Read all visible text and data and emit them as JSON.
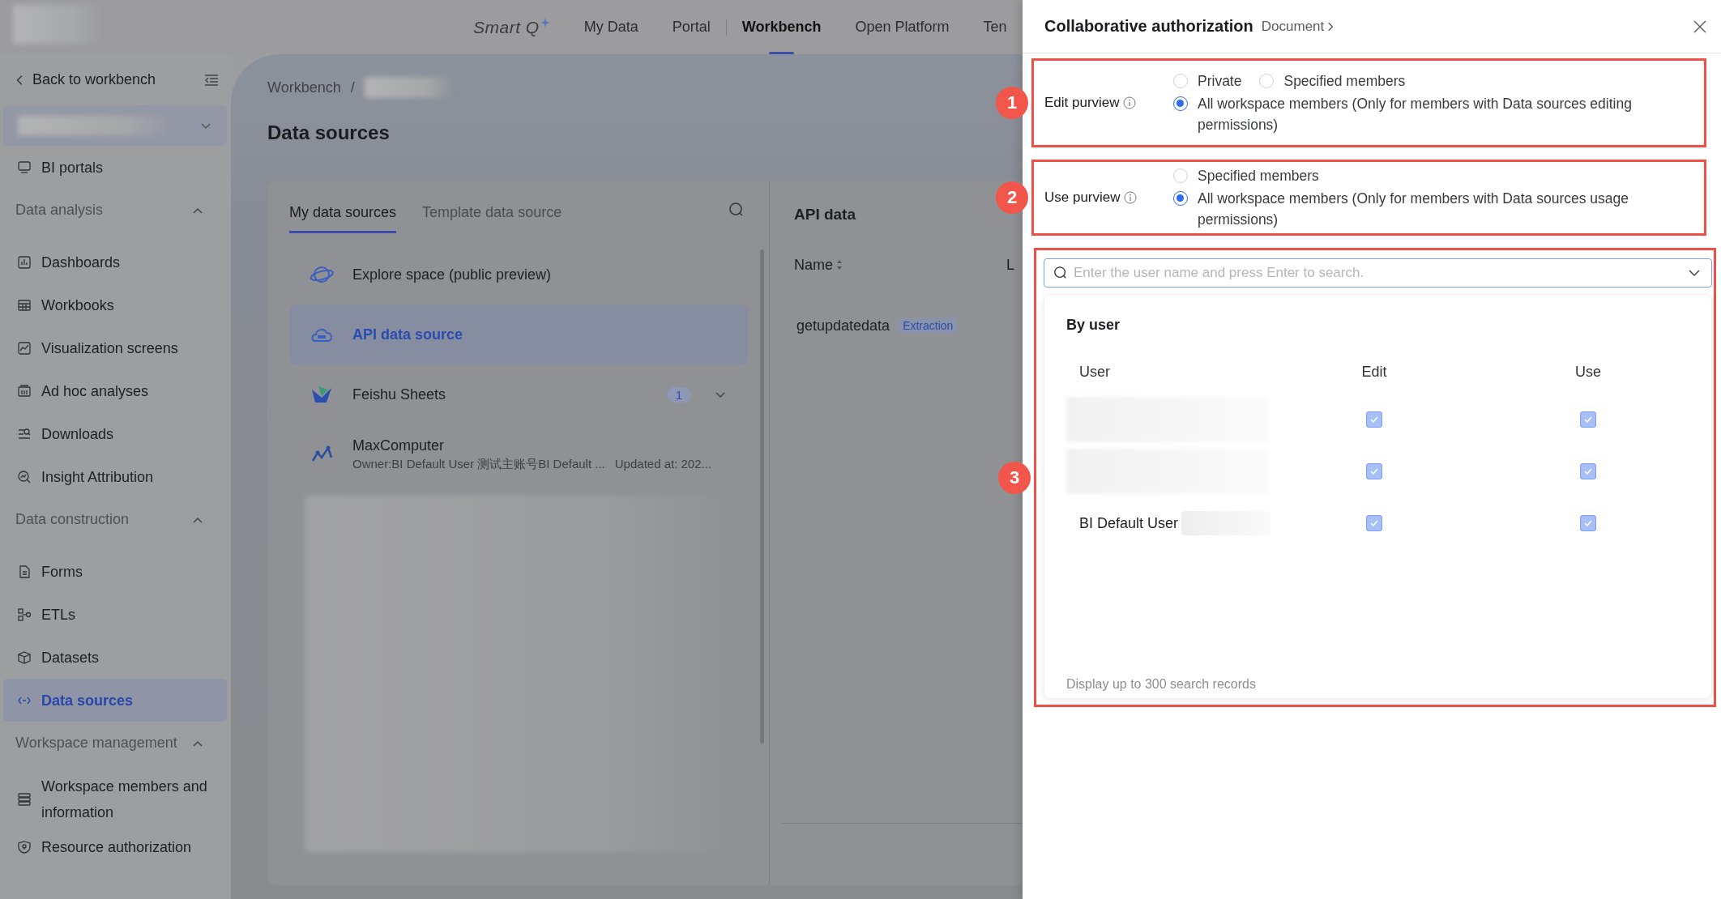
{
  "top_nav": {
    "logo": "Smart Q",
    "items": [
      {
        "label": "My Data",
        "selected": false
      },
      {
        "label": "Portal",
        "selected": false
      },
      {
        "label": "Workbench",
        "selected": true
      },
      {
        "label": "Open Platform",
        "selected": false
      },
      {
        "label": "Ten",
        "selected": false
      }
    ]
  },
  "sidebar": {
    "back_link": "Back to workbench",
    "sections": [
      {
        "items": [
          {
            "label": "BI portals",
            "selected": false
          }
        ]
      },
      {
        "title": "Data analysis",
        "expanded": true,
        "items": [
          {
            "label": "Dashboards",
            "selected": false
          },
          {
            "label": "Workbooks",
            "selected": false
          },
          {
            "label": "Visualization screens",
            "selected": false
          },
          {
            "label": "Ad hoc analyses",
            "selected": false
          },
          {
            "label": "Downloads",
            "selected": false
          },
          {
            "label": "Insight Attribution",
            "selected": false
          }
        ]
      },
      {
        "title": "Data construction",
        "expanded": true,
        "items": [
          {
            "label": "Forms",
            "selected": false
          },
          {
            "label": "ETLs",
            "selected": false
          },
          {
            "label": "Datasets",
            "selected": false
          },
          {
            "label": "Data sources",
            "selected": true
          }
        ]
      },
      {
        "title": "Workspace management",
        "expanded": true,
        "items": [
          {
            "label": "Workspace members and information",
            "selected": false
          },
          {
            "label": "Resource authorization",
            "selected": false
          }
        ]
      }
    ]
  },
  "breadcrumb": [
    "Workbench",
    "/"
  ],
  "page_title": "Data sources",
  "source_tabs": [
    {
      "label": "My data sources",
      "selected": true
    },
    {
      "label": "Template data source",
      "selected": false
    }
  ],
  "sources": [
    {
      "name": "Explore space (public preview)",
      "selected": false
    },
    {
      "name": "API data source",
      "selected": true
    },
    {
      "name": "Feishu Sheets",
      "selected": false,
      "count": "1"
    },
    {
      "name": "MaxComputer",
      "selected": false,
      "owner": "Owner:BI Default User 测试主账号BI Default ...",
      "updated": "Updated at: 202..."
    }
  ],
  "detail": {
    "title": "API data",
    "columns": [
      "Name",
      "L"
    ],
    "rows": [
      {
        "name": "getupdatedata",
        "tag": "Extraction"
      }
    ]
  },
  "drawer": {
    "title": "Collaborative authorization",
    "subtitle": "Document",
    "edit_purview": {
      "marker": "1",
      "label": "Edit purview",
      "options": [
        {
          "label": "Private",
          "selected": false
        },
        {
          "label": "Specified members",
          "selected": false
        },
        {
          "label": "All workspace members (Only for members with Data sources editing permissions)",
          "selected": true
        }
      ]
    },
    "use_purview": {
      "marker": "2",
      "label": "Use purview",
      "options": [
        {
          "label": "Specified members",
          "selected": false
        },
        {
          "label": "All workspace members (Only for members with Data sources usage permissions)",
          "selected": true
        }
      ]
    },
    "members": {
      "marker": "3",
      "placeholder": "Enter the user name and press Enter to search.",
      "heading": "By user",
      "columns": [
        "User",
        "Edit",
        "Use"
      ],
      "rows": [
        {
          "edit": true,
          "use": true
        },
        {
          "edit": true,
          "use": true
        },
        {
          "user": "BI Default User",
          "edit": true,
          "use": true
        }
      ],
      "footer": "Display up to 300 search records"
    }
  }
}
